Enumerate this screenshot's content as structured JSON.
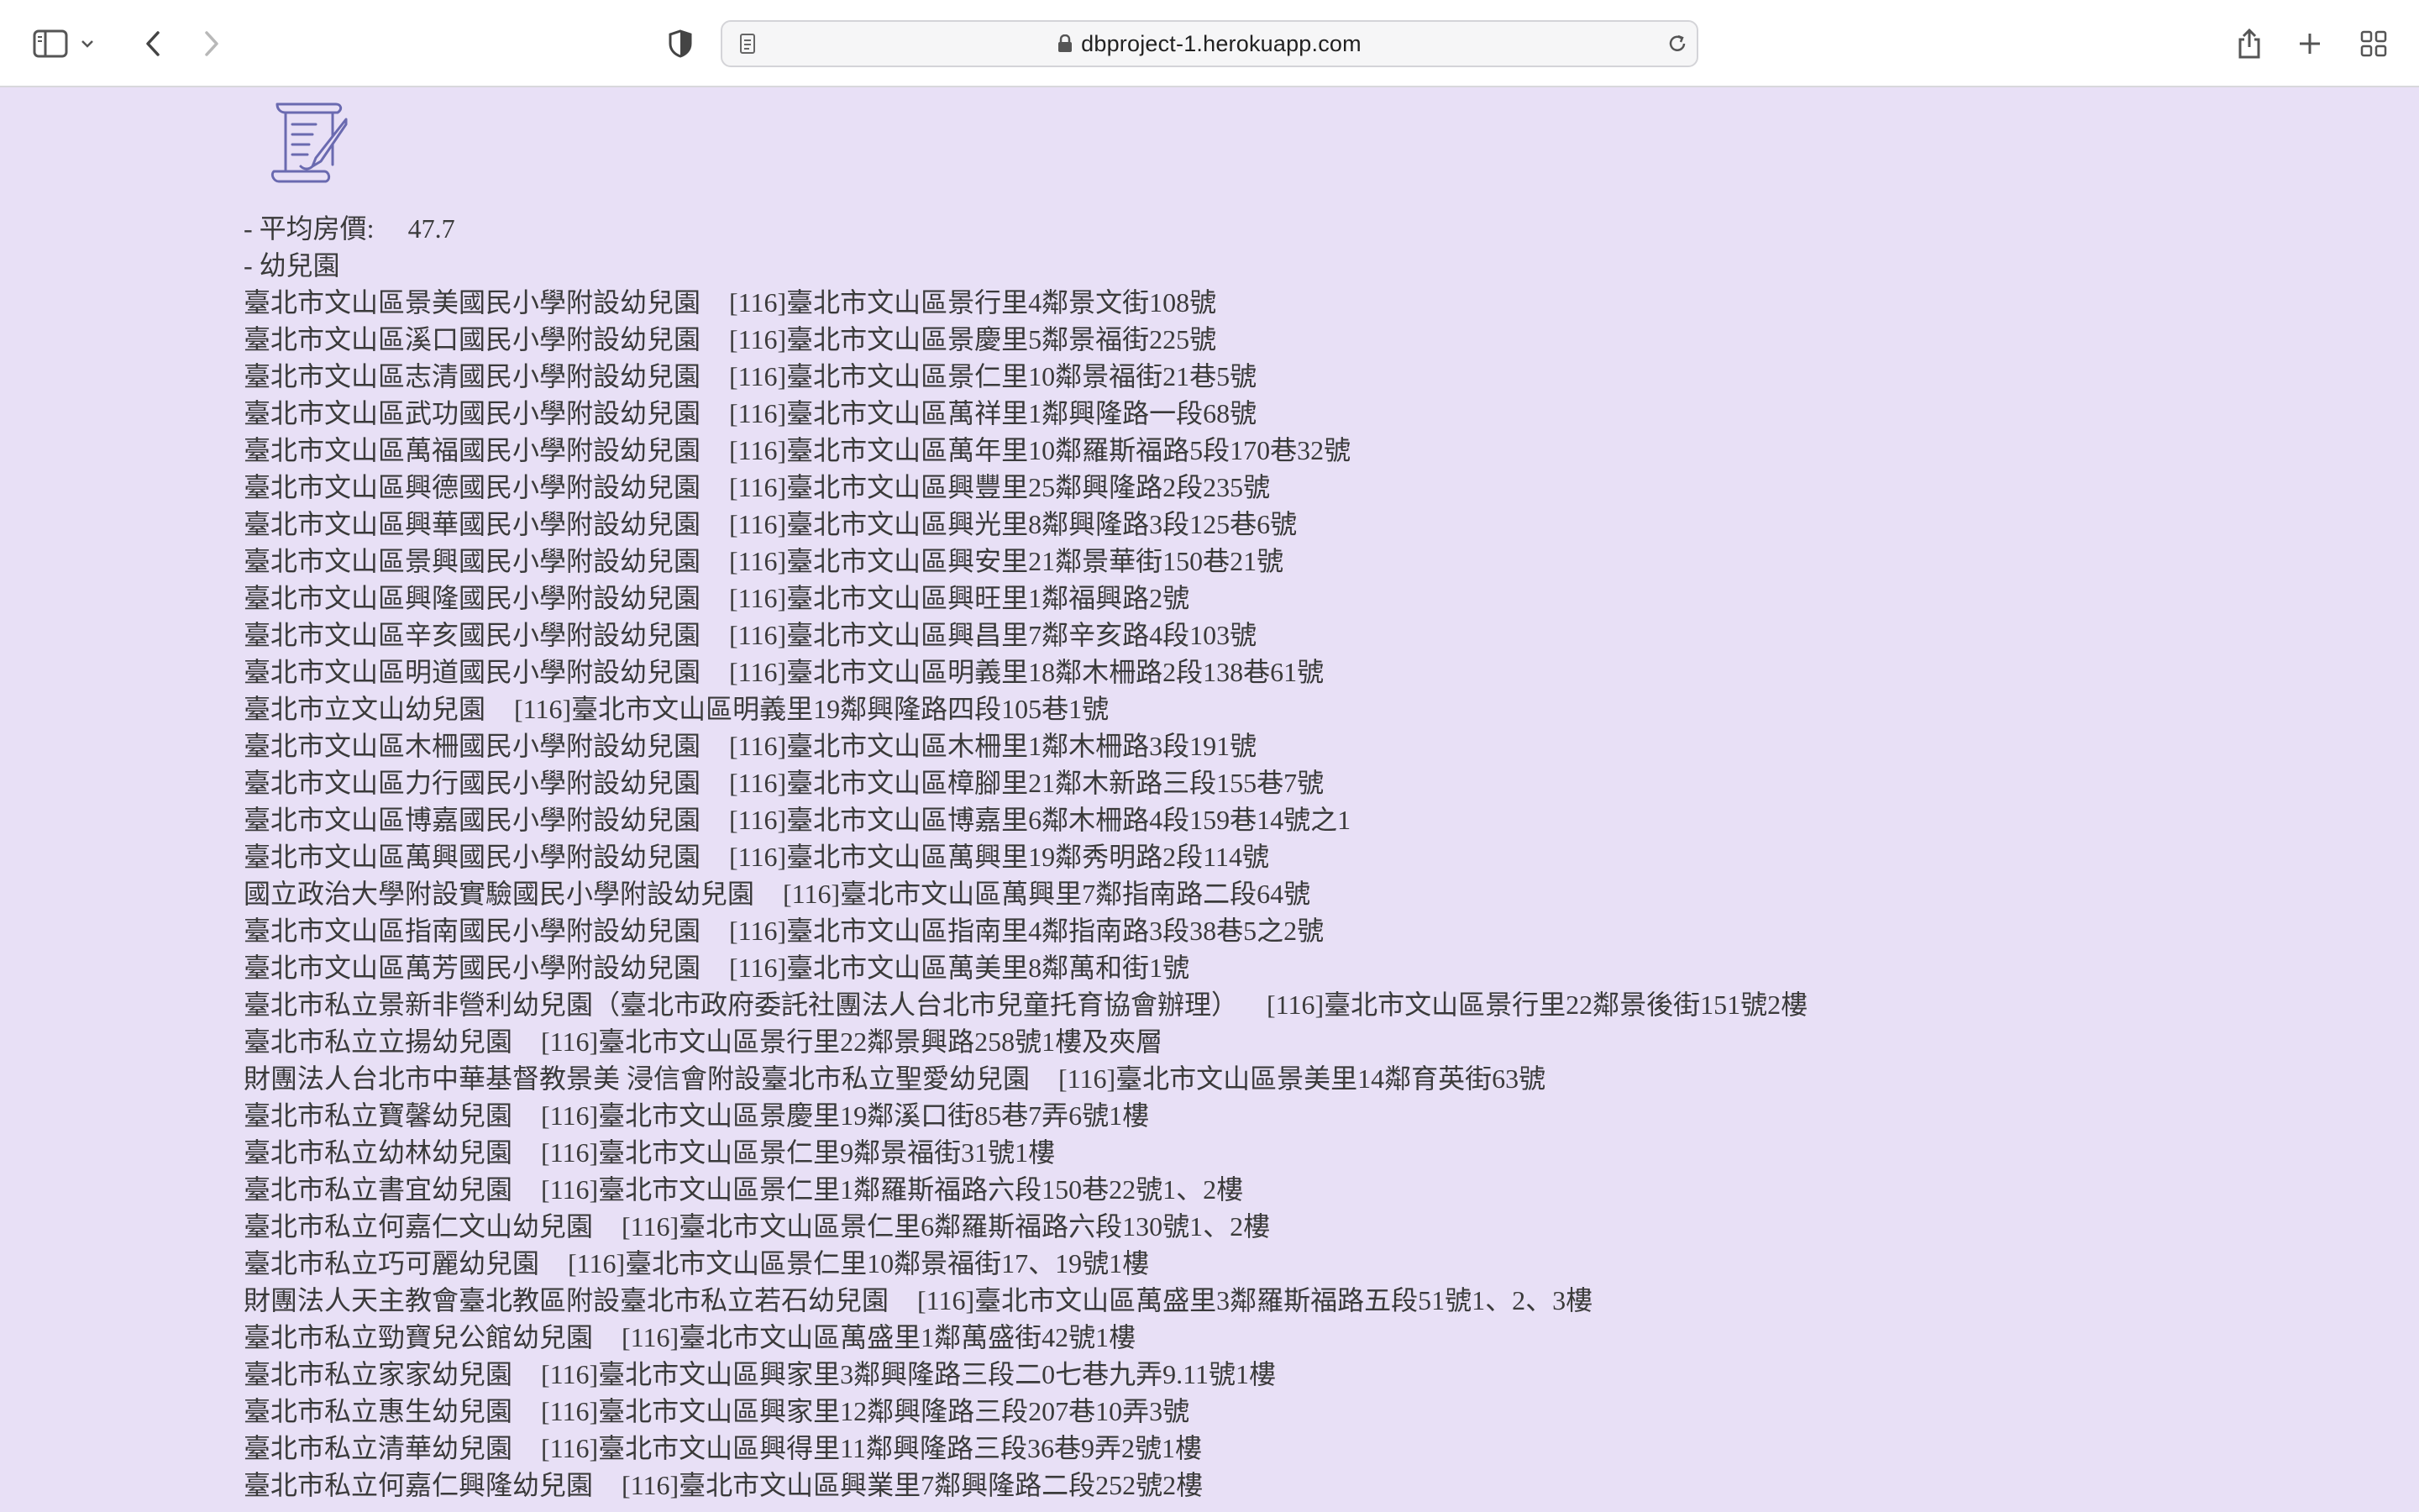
{
  "browser": {
    "url": "dbproject-1.herokuapp.com",
    "icons": [
      "sidebar-icon",
      "chevron-down-icon",
      "back-icon",
      "forward-icon",
      "shield-icon",
      "page-icon",
      "lock-icon",
      "reload-icon",
      "share-icon",
      "plus-icon",
      "tabs-grid-icon"
    ]
  },
  "page": {
    "logo_icon": "scroll-quill-icon",
    "avg_price_label": "- 平均房價:",
    "avg_price_value": "47.7",
    "kindergarten_label": "- 幼兒園",
    "kindergartens": [
      {
        "name": "臺北市文山區景美國民小學附設幼兒園",
        "address": "[116]臺北市文山區景行里4鄰景文街108號"
      },
      {
        "name": "臺北市文山區溪口國民小學附設幼兒園",
        "address": "[116]臺北市文山區景慶里5鄰景福街225號"
      },
      {
        "name": "臺北市文山區志清國民小學附設幼兒園",
        "address": "[116]臺北市文山區景仁里10鄰景福街21巷5號"
      },
      {
        "name": "臺北市文山區武功國民小學附設幼兒園",
        "address": "[116]臺北市文山區萬祥里1鄰興隆路一段68號"
      },
      {
        "name": "臺北市文山區萬福國民小學附設幼兒園",
        "address": "[116]臺北市文山區萬年里10鄰羅斯福路5段170巷32號"
      },
      {
        "name": "臺北市文山區興德國民小學附設幼兒園",
        "address": "[116]臺北市文山區興豐里25鄰興隆路2段235號"
      },
      {
        "name": "臺北市文山區興華國民小學附設幼兒園",
        "address": "[116]臺北市文山區興光里8鄰興隆路3段125巷6號"
      },
      {
        "name": "臺北市文山區景興國民小學附設幼兒園",
        "address": "[116]臺北市文山區興安里21鄰景華街150巷21號"
      },
      {
        "name": "臺北市文山區興隆國民小學附設幼兒園",
        "address": "[116]臺北市文山區興旺里1鄰福興路2號"
      },
      {
        "name": "臺北市文山區辛亥國民小學附設幼兒園",
        "address": "[116]臺北市文山區興昌里7鄰辛亥路4段103號"
      },
      {
        "name": "臺北市文山區明道國民小學附設幼兒園",
        "address": "[116]臺北市文山區明義里18鄰木柵路2段138巷61號"
      },
      {
        "name": "臺北市立文山幼兒園",
        "address": "[116]臺北市文山區明義里19鄰興隆路四段105巷1號"
      },
      {
        "name": "臺北市文山區木柵國民小學附設幼兒園",
        "address": "[116]臺北市文山區木柵里1鄰木柵路3段191號"
      },
      {
        "name": "臺北市文山區力行國民小學附設幼兒園",
        "address": "[116]臺北市文山區樟腳里21鄰木新路三段155巷7號"
      },
      {
        "name": "臺北市文山區博嘉國民小學附設幼兒園",
        "address": "[116]臺北市文山區博嘉里6鄰木柵路4段159巷14號之1"
      },
      {
        "name": "臺北市文山區萬興國民小學附設幼兒園",
        "address": "[116]臺北市文山區萬興里19鄰秀明路2段114號"
      },
      {
        "name": "國立政治大學附設實驗國民小學附設幼兒園",
        "address": "[116]臺北市文山區萬興里7鄰指南路二段64號"
      },
      {
        "name": "臺北市文山區指南國民小學附設幼兒園",
        "address": "[116]臺北市文山區指南里4鄰指南路3段38巷5之2號"
      },
      {
        "name": "臺北市文山區萬芳國民小學附設幼兒園",
        "address": "[116]臺北市文山區萬美里8鄰萬和街1號"
      },
      {
        "name": "臺北市私立景新非營利幼兒園（臺北市政府委託社團法人台北市兒童托育協會辦理）",
        "address": "[116]臺北市文山區景行里22鄰景後街151號2樓"
      },
      {
        "name": "臺北市私立立揚幼兒園",
        "address": "[116]臺北市文山區景行里22鄰景興路258號1樓及夾層"
      },
      {
        "name": "財團法人台北市中華基督教景美 浸信會附設臺北市私立聖愛幼兒園",
        "address": "[116]臺北市文山區景美里14鄰育英街63號"
      },
      {
        "name": "臺北市私立寶馨幼兒園",
        "address": "[116]臺北市文山區景慶里19鄰溪口街85巷7弄6號1樓"
      },
      {
        "name": "臺北市私立幼林幼兒園",
        "address": "[116]臺北市文山區景仁里9鄰景福街31號1樓"
      },
      {
        "name": "臺北市私立書宜幼兒園",
        "address": "[116]臺北市文山區景仁里1鄰羅斯福路六段150巷22號1、2樓"
      },
      {
        "name": "臺北市私立何嘉仁文山幼兒園",
        "address": "[116]臺北市文山區景仁里6鄰羅斯福路六段130號1、2樓"
      },
      {
        "name": "臺北市私立巧可麗幼兒園",
        "address": "[116]臺北市文山區景仁里10鄰景福街17、19號1樓"
      },
      {
        "name": "財團法人天主教會臺北教區附設臺北市私立若石幼兒園",
        "address": "[116]臺北市文山區萬盛里3鄰羅斯福路五段51號1、2、3樓"
      },
      {
        "name": "臺北市私立勁寶兒公館幼兒園",
        "address": "[116]臺北市文山區萬盛里1鄰萬盛街42號1樓"
      },
      {
        "name": "臺北市私立家家幼兒園",
        "address": "[116]臺北市文山區興家里3鄰興隆路三段二0七巷九弄9.11號1樓"
      },
      {
        "name": "臺北市私立惠生幼兒園",
        "address": "[116]臺北市文山區興家里12鄰興隆路三段207巷10弄3號"
      },
      {
        "name": "臺北市私立清華幼兒園",
        "address": "[116]臺北市文山區興得里11鄰興隆路三段36巷9弄2號1樓"
      },
      {
        "name": "臺北市私立何嘉仁興隆幼兒園",
        "address": "[116]臺北市文山區興業里7鄰興隆路二段252號2樓"
      }
    ]
  }
}
